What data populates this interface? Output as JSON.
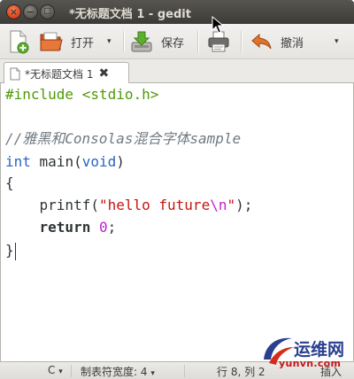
{
  "window": {
    "title": "*无标题文档 1 - gedit"
  },
  "toolbar": {
    "new_icon": "new-document-icon",
    "open_label": "打开",
    "save_label": "保存",
    "print_icon": "print-icon",
    "undo_label": "撤消",
    "dropdown_glyph": "▾"
  },
  "tab": {
    "label": "*无标题文档 1",
    "close_glyph": "✖"
  },
  "editor": {
    "lines": [
      "#include <stdio.h>",
      "",
      "//雅黑和Consolas混合字体sample",
      "int main(void)",
      "{",
      "    printf(\"hello future\\n\");",
      "    return 0;",
      "}"
    ],
    "tokens": {
      "include": "#include <stdio.h>",
      "comment": "//雅黑和Consolas混合字体sample",
      "int_kw": "int",
      "main_sig_open": " main(",
      "void_kw": "void",
      "main_sig_close": ")",
      "brace_open": "{",
      "indent": "    ",
      "printf_call": "printf(",
      "string_body": "\"hello future",
      "escape": "\\n",
      "string_close": "\"",
      "printf_end": ");",
      "return_kw": "return",
      "zero": "0",
      "semicolon": ";",
      "brace_close": "}"
    },
    "colors": {
      "preprocessor": "#4e9a06",
      "comment": "#6f7a82",
      "type": "#2a64c2",
      "string": "#c4160e",
      "escape": "#c01ecf"
    }
  },
  "statusbar": {
    "language": "C",
    "tab_width": "制表符宽度: 4",
    "position": "行 8, 列 2",
    "mode": "插入"
  },
  "watermark": {
    "text": "运维网",
    "url": "yunvn.com"
  }
}
